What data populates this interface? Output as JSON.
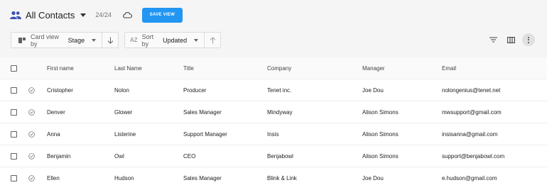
{
  "header": {
    "title": "All Contacts",
    "count": "24/24",
    "save_label": "SAVE VIEW"
  },
  "toolbar": {
    "cardview_prefix": "Card view by",
    "cardview_value": "Stage",
    "sort_prefix": "Sort by",
    "sort_value": "Updated",
    "az_glyph": "AZ"
  },
  "table": {
    "columns": [
      "First name",
      "Last Name",
      "Title",
      "Company",
      "Manager",
      "Email"
    ],
    "rows": [
      [
        "Cristopher",
        "Nolon",
        "Producer",
        "Tenet inc.",
        "Joe Dou",
        "nolongenius@tenet.net"
      ],
      [
        "Denver",
        "Glower",
        "Sales Manager",
        "Mindyway",
        "Alison Simons",
        "mwsupport@gmail.com"
      ],
      [
        "Anna",
        "Listerine",
        "Support Manager",
        "Insis",
        "Alison Simons",
        "insisanna@gmail.com"
      ],
      [
        "Benjamin",
        "Owl",
        "CEO",
        "Benjabowl",
        "Alison Simons",
        "support@benjabowl.com"
      ],
      [
        "Ellen",
        "Hudson",
        "Sales Manager",
        "Blink & Link",
        "Joe Dou",
        "e.hudson@gmail.com"
      ]
    ]
  },
  "colors": {
    "accent": "#2196f3",
    "people_icon": "#3f51b5"
  },
  "icons": [
    "people-icon",
    "caret-down-icon",
    "cloud-icon",
    "card-view-icon",
    "arrow-down-icon",
    "arrow-up-icon",
    "filter-icon",
    "columns-icon",
    "more-vertical-icon",
    "check-circle-icon"
  ]
}
